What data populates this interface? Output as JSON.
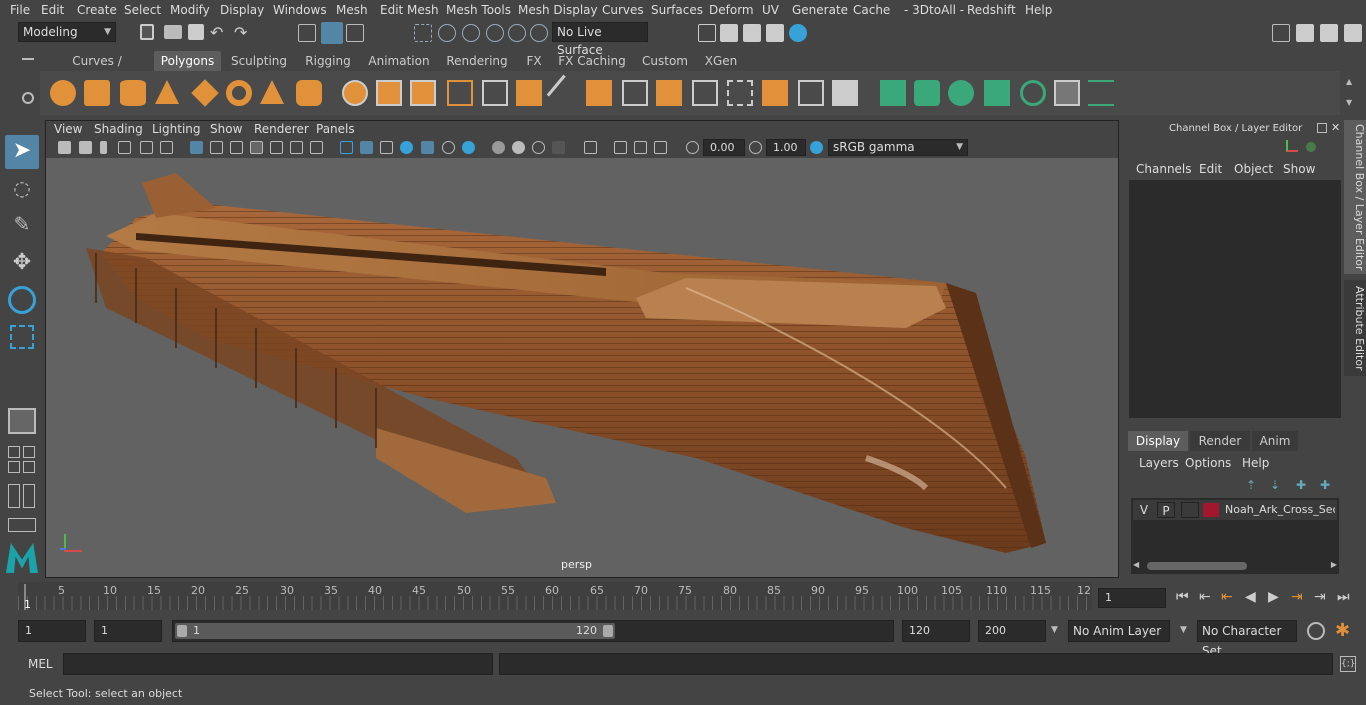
{
  "menu": [
    "File",
    "Edit",
    "Create",
    "Select",
    "Modify",
    "Display",
    "Windows",
    "Mesh",
    "Edit Mesh",
    "Mesh Tools",
    "Mesh Display",
    "Curves",
    "Surfaces",
    "Deform",
    "UV",
    "Generate",
    "Cache",
    "- 3DtoAll -",
    "Redshift",
    "Help"
  ],
  "toolbar": {
    "mode": "Modeling",
    "live_surface": "No Live Surface"
  },
  "shelf_tabs": [
    "Curves / Surfaces",
    "Polygons",
    "Sculpting",
    "Rigging",
    "Animation",
    "Rendering",
    "FX",
    "FX Caching",
    "Custom",
    "XGen"
  ],
  "shelf_active": "Polygons",
  "viewport": {
    "menu": [
      "View",
      "Shading",
      "Lighting",
      "Show",
      "Renderer",
      "Panels"
    ],
    "exposure": "0.00",
    "gamma": "1.00",
    "color_space": "sRGB gamma",
    "camera_label": "persp"
  },
  "channel_box": {
    "title": "Channel Box / Layer Editor",
    "menu": [
      "Channels",
      "Edit",
      "Object",
      "Show"
    ]
  },
  "layer_editor": {
    "tabs": [
      "Display",
      "Render",
      "Anim"
    ],
    "active_tab": "Display",
    "menu": [
      "Layers",
      "Options",
      "Help"
    ],
    "layers": [
      {
        "v": "V",
        "p": "P",
        "name": "Noah_Ark_Cross_Section",
        "color": "#a3172e"
      }
    ]
  },
  "side_tabs": [
    "Channel Box / Layer Editor",
    "Attribute Editor"
  ],
  "timeline": {
    "ticks": [
      "5",
      "10",
      "15",
      "20",
      "25",
      "30",
      "35",
      "40",
      "45",
      "50",
      "55",
      "60",
      "65",
      "70",
      "75",
      "80",
      "85",
      "90",
      "95",
      "100",
      "105",
      "110",
      "115",
      "12"
    ],
    "start_marker": "1",
    "current_frame": "1"
  },
  "range": {
    "start": "1",
    "playback_start": "1",
    "slider_start": "1",
    "slider_end": "120",
    "playback_end": "120",
    "end": "200",
    "anim_layer": "No Anim Layer",
    "character_set": "No Character Set"
  },
  "command_line": {
    "label": "MEL"
  },
  "status": "Select Tool: select an object",
  "colors": {
    "accent": "#5285a6",
    "shelf_orange": "#e0913a",
    "shelf_green": "#3aa87a",
    "layer_color": "#a3172e"
  }
}
